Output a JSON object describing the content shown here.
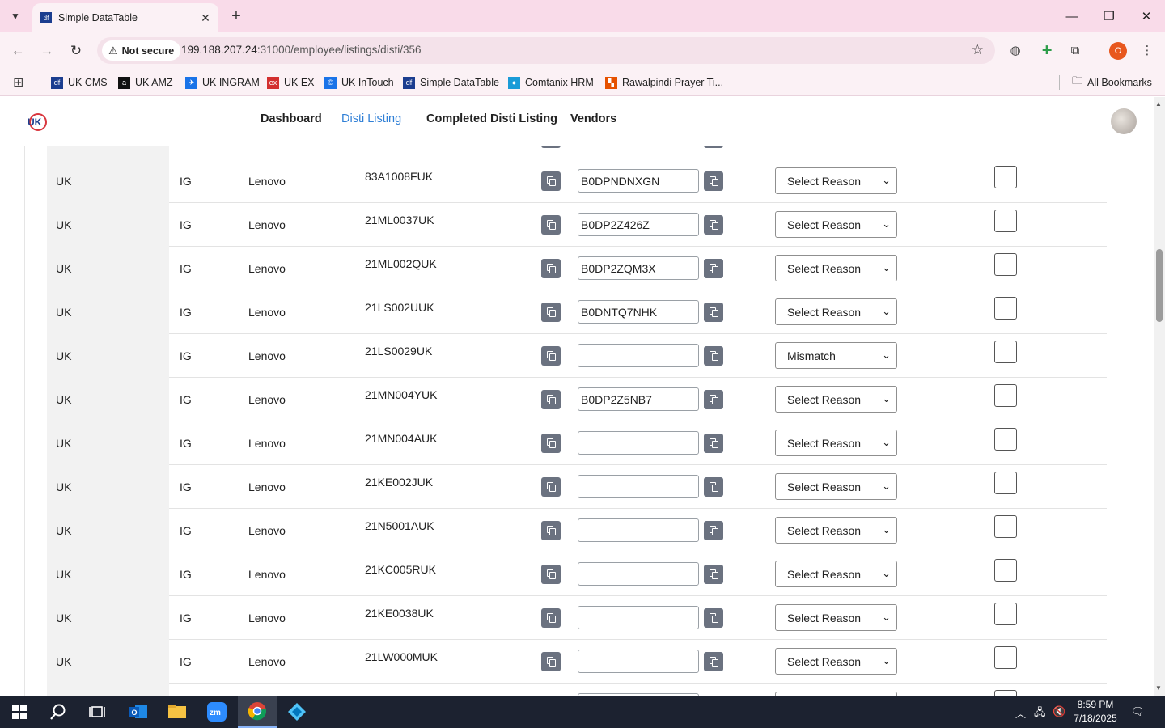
{
  "browser": {
    "tab_title": "Simple DataTable",
    "tab_favicon": "df",
    "security_label": "Not secure",
    "url_host": "199.188.207.24",
    "url_path": ":31000/employee/listings/disti/356",
    "profile_initial": "O",
    "bookmarks": [
      {
        "label": "UK CMS",
        "color": "#1b3d8f",
        "glyph": "df"
      },
      {
        "label": "UK AMZ",
        "color": "#111111",
        "glyph": "a"
      },
      {
        "label": "UK INGRAM",
        "color": "#1a73e8",
        "glyph": "✈"
      },
      {
        "label": "UK EX",
        "color": "#d32f2f",
        "glyph": "ex"
      },
      {
        "label": "UK InTouch",
        "color": "#1a73e8",
        "glyph": "©"
      },
      {
        "label": "Simple DataTable",
        "color": "#1b3d8f",
        "glyph": "df"
      },
      {
        "label": "Comtanix HRM",
        "color": "#1a9bd7",
        "glyph": "●"
      },
      {
        "label": "Rawalpindi Prayer Ti...",
        "color": "#e65100",
        "glyph": "▚"
      }
    ],
    "all_bookmarks": "All Bookmarks"
  },
  "app": {
    "nav": [
      "Dashboard",
      "Disti Listing",
      "Completed Disti Listing",
      "Vendors"
    ],
    "active_nav": "Disti Listing"
  },
  "table": {
    "rows": [
      {
        "country": "UK",
        "dist": "IG",
        "brand": "Lenovo",
        "sku": "83A1008FUK",
        "asin": "B0DPNDNXGN",
        "reason": "Select Reason"
      },
      {
        "country": "UK",
        "dist": "IG",
        "brand": "Lenovo",
        "sku": "21ML0037UK",
        "asin": "B0DP2Z426Z",
        "reason": "Select Reason"
      },
      {
        "country": "UK",
        "dist": "IG",
        "brand": "Lenovo",
        "sku": "21ML002QUK",
        "asin": "B0DP2ZQM3X",
        "reason": "Select Reason"
      },
      {
        "country": "UK",
        "dist": "IG",
        "brand": "Lenovo",
        "sku": "21LS002UUK",
        "asin": "B0DNTQ7NHK",
        "reason": "Select Reason"
      },
      {
        "country": "UK",
        "dist": "IG",
        "brand": "Lenovo",
        "sku": "21LS0029UK",
        "asin": "",
        "reason": "Mismatch"
      },
      {
        "country": "UK",
        "dist": "IG",
        "brand": "Lenovo",
        "sku": "21MN004YUK",
        "asin": "B0DP2Z5NB7",
        "reason": "Select Reason"
      },
      {
        "country": "UK",
        "dist": "IG",
        "brand": "Lenovo",
        "sku": "21MN004AUK",
        "asin": "",
        "reason": "Select Reason"
      },
      {
        "country": "UK",
        "dist": "IG",
        "brand": "Lenovo",
        "sku": "21KE002JUK",
        "asin": "",
        "reason": "Select Reason"
      },
      {
        "country": "UK",
        "dist": "IG",
        "brand": "Lenovo",
        "sku": "21N5001AUK",
        "asin": "",
        "reason": "Select Reason"
      },
      {
        "country": "UK",
        "dist": "IG",
        "brand": "Lenovo",
        "sku": "21KC005RUK",
        "asin": "",
        "reason": "Select Reason"
      },
      {
        "country": "UK",
        "dist": "IG",
        "brand": "Lenovo",
        "sku": "21KE0038UK",
        "asin": "",
        "reason": "Select Reason"
      },
      {
        "country": "UK",
        "dist": "IG",
        "brand": "Lenovo",
        "sku": "21LW000MUK",
        "asin": "",
        "reason": "Select Reason"
      }
    ]
  },
  "taskbar": {
    "time": "8:59 PM",
    "date": "7/18/2025"
  }
}
